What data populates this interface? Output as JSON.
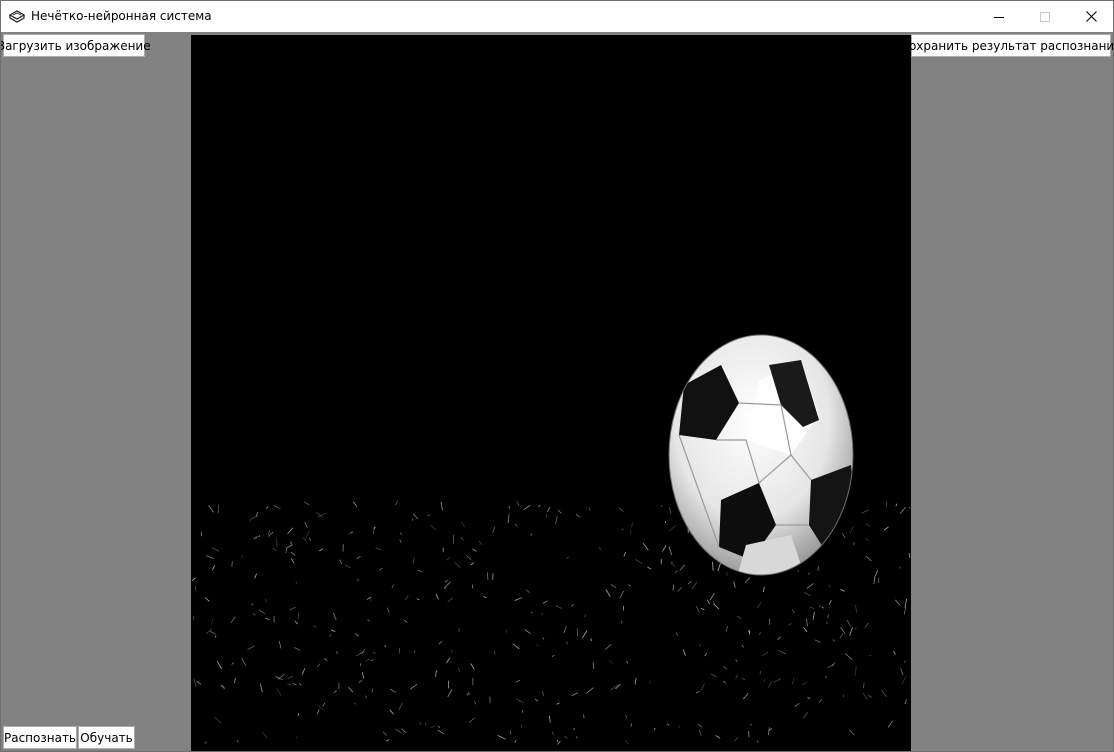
{
  "window": {
    "title": "Нечётко-нейронная система",
    "app_icon": "app-icon",
    "controls": [
      "minimize-icon",
      "maximize-icon",
      "close-icon"
    ]
  },
  "toolbar": {
    "load_label": "Загрузить изображение",
    "save_label": "Сохранить результат распознания"
  },
  "bottom": {
    "recognize_label": "Распознать",
    "train_label": "Обучать"
  },
  "image": {
    "subject": "soccer-ball-on-grass-grayscale"
  },
  "colors": {
    "client_bg": "#828282",
    "image_bg": "#000000",
    "button_bg": "#ffffff",
    "button_border": "#adadad"
  }
}
